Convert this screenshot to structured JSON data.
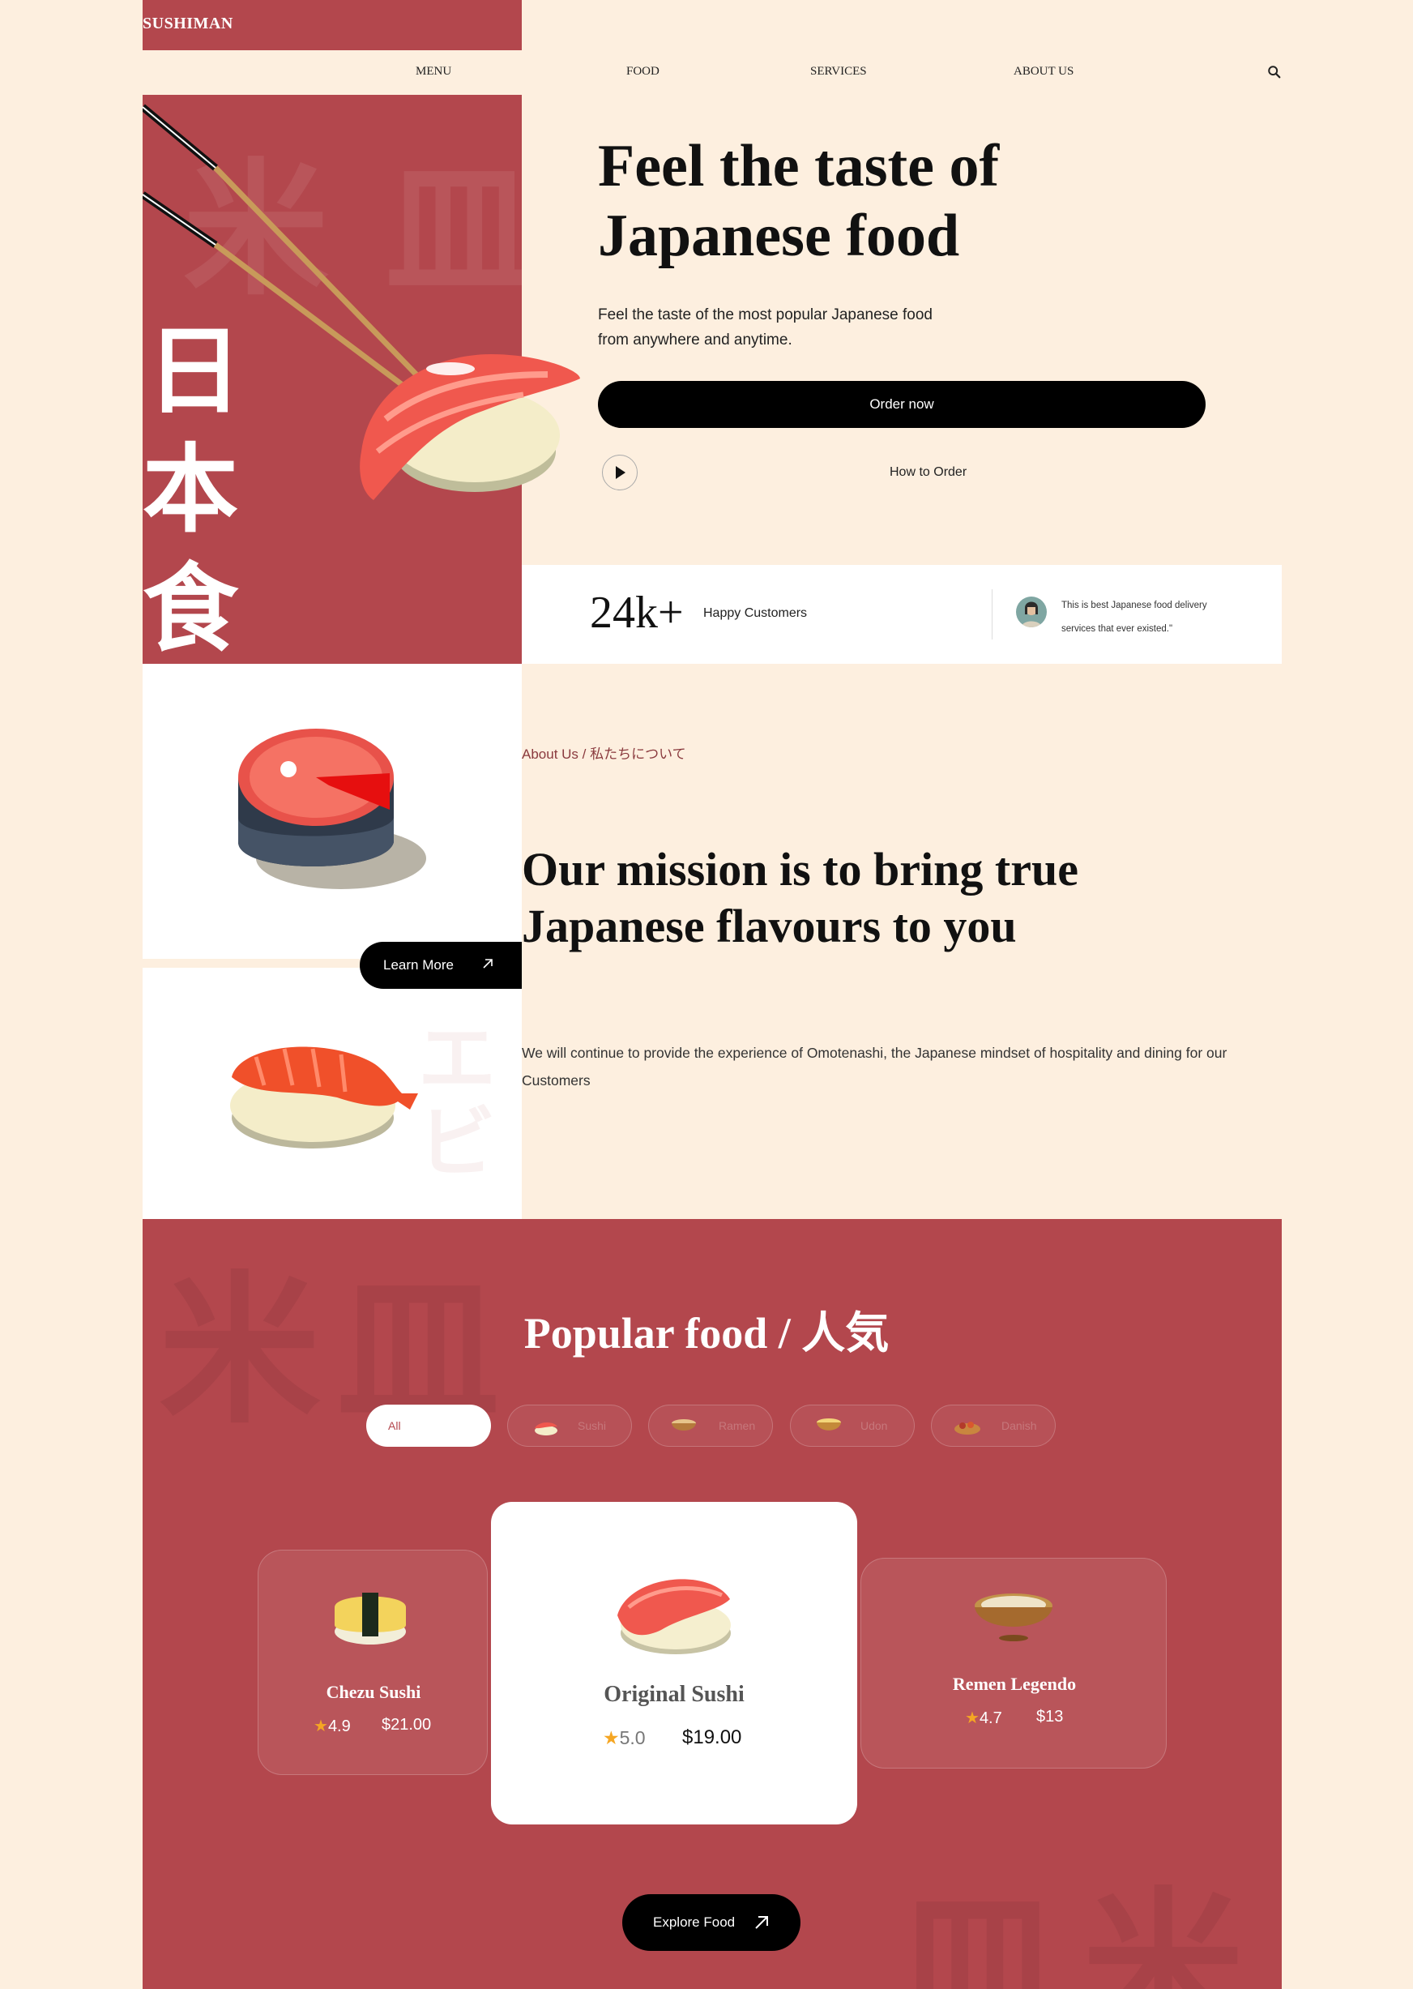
{
  "header": {
    "logo": "SUSHIMAN",
    "nav": [
      "MENU",
      "FOOD",
      "SERVICES",
      "ABOUT US"
    ],
    "search_icon": "search-icon"
  },
  "hero": {
    "kanji": [
      "日",
      "本",
      "食"
    ],
    "title": "Feel the taste of Japanese food",
    "subtitle": "Feel the taste of the most popular Japanese food from anywhere and anytime.",
    "order_button": "Order now",
    "how_to_order": "How to Order",
    "stat_value": "24k+",
    "stat_label": "Happy Customers",
    "quote": "This is best Japanese food delivery services that ever existed.\""
  },
  "about": {
    "learn_more": "Learn More",
    "breadcrumb": "About Us / 私たちについて",
    "title": "Our mission is to bring true Japanese flavours to you",
    "text": "We will continue to provide the experience of Omotenashi, the Japanese mindset of hospitality and dining for our Customers",
    "ebi_kana": "エビ"
  },
  "popular": {
    "title": "Popular food / 人気",
    "filters": [
      "All",
      "Sushi",
      "Ramen",
      "Udon",
      "Danish"
    ],
    "foods": [
      {
        "name": "Chezu Sushi",
        "rating": "4.9",
        "price": "$21.00"
      },
      {
        "name": "Original Sushi",
        "rating": "5.0",
        "price": "$19.00"
      },
      {
        "name": "Remen Legendo",
        "rating": "4.7",
        "price": "$13"
      }
    ],
    "explore_button": "Explore Food"
  },
  "colors": {
    "brand_red": "#b3474d",
    "background": "#fdefdf",
    "button": "#000000",
    "star": "#f5a623"
  }
}
